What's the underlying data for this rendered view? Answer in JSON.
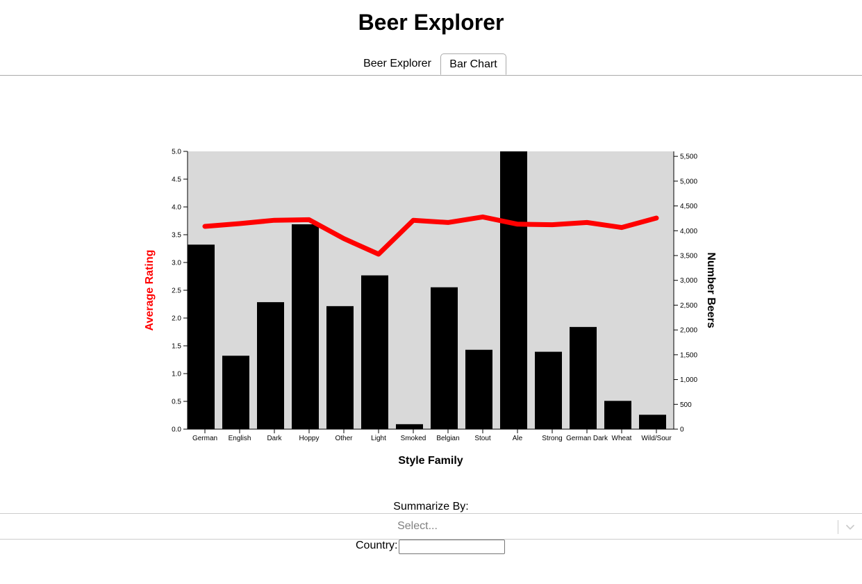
{
  "app": {
    "title": "Beer Explorer"
  },
  "tabs": [
    {
      "label": "Beer Explorer",
      "active": false
    },
    {
      "label": "Bar Chart",
      "active": true
    }
  ],
  "chart_data": {
    "type": "bar",
    "categories": [
      "German",
      "English",
      "Dark",
      "Hoppy",
      "Other",
      "Light",
      "Smoked",
      "Belgian",
      "Stout",
      "Ale",
      "Strong",
      "German Dark",
      "Wheat",
      "Wild/Sour"
    ],
    "series": [
      {
        "name": "Number Beers",
        "type": "bar",
        "axis": "right",
        "color": "#000000",
        "values": [
          3720,
          1480,
          2560,
          4130,
          2480,
          3100,
          100,
          2860,
          1600,
          5600,
          1560,
          2060,
          570,
          290
        ]
      },
      {
        "name": "Average Rating",
        "type": "line",
        "axis": "left",
        "color": "#ff0000",
        "values": [
          3.65,
          3.7,
          3.76,
          3.77,
          3.43,
          3.15,
          3.76,
          3.72,
          3.82,
          3.69,
          3.68,
          3.72,
          3.63,
          3.8
        ]
      }
    ],
    "title": "",
    "xlabel": "Style Family",
    "ylabel_left": "Average Rating",
    "ylabel_right": "Number Beers",
    "ylim_left": [
      0,
      5
    ],
    "ylim_right": [
      0,
      5600
    ],
    "yticks_left": [
      0,
      0.5,
      1,
      1.5,
      2,
      2.5,
      3,
      3.5,
      4,
      4.5,
      5
    ],
    "yticks_left_labels": [
      "0.0",
      "0.5",
      "1.0",
      "1.5",
      "2.0",
      "2.5",
      "3.0",
      "3.5",
      "4.0",
      "4.5",
      "5.0"
    ],
    "yticks_right": [
      0,
      500,
      1000,
      1500,
      2000,
      2500,
      3000,
      3500,
      4000,
      4500,
      5000,
      5500
    ],
    "yticks_right_labels": [
      "0",
      "500",
      "1,000",
      "1,500",
      "2,000",
      "2,500",
      "3,000",
      "3,500",
      "4,000",
      "4,500",
      "5,000",
      "5,500"
    ],
    "plot_background": "#d9d9d9",
    "grid": false
  },
  "controls": {
    "summarize_label": "Summarize By:",
    "select_placeholder": "Select...",
    "country_label": "Country:",
    "country_value": ""
  }
}
